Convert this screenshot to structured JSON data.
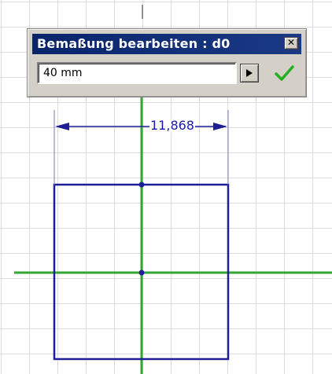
{
  "dialog": {
    "title": "Bemaßung bearbeiten : d0",
    "close_label": "✕",
    "input_value": "40 mm",
    "expand_icon": "triangle-right-icon",
    "accept_icon": "checkmark-icon"
  },
  "sketch": {
    "dimension_text": "11,868",
    "colors": {
      "sketch_lines": "#1e1e96",
      "axes": "#33a633",
      "grid": "#dcdcdc",
      "checkmark": "#22b022"
    }
  }
}
